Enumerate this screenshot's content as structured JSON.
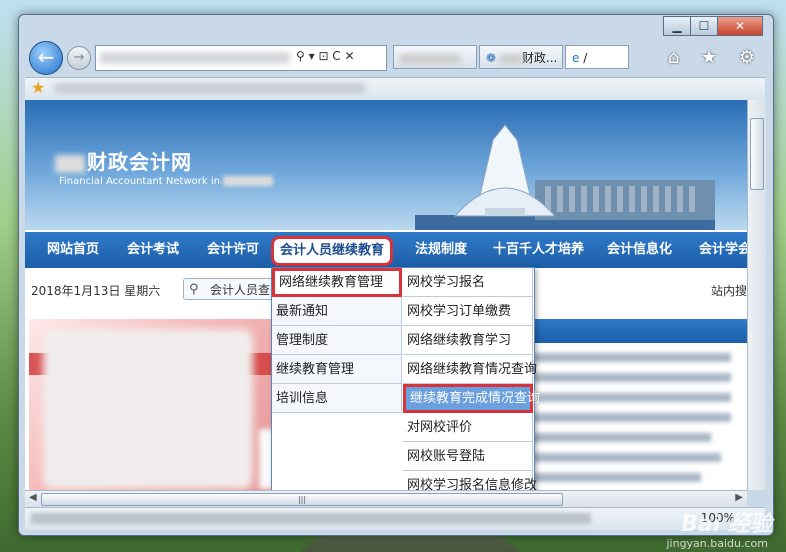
{
  "browser": {
    "window_controls": {
      "minimize": "▁",
      "maximize": "☐",
      "close": "✕"
    },
    "back_icon": "arrow-left",
    "forward_icon": "arrow-right",
    "address_icons": "⚲ ▾ ⊡ C ✕",
    "tabs": [
      {
        "label": "",
        "active": false
      },
      {
        "label": "财政...",
        "active": false
      },
      {
        "label": "/",
        "active": true
      }
    ],
    "tool_icons": "⌂ ★ ⚙",
    "zoom": "100%"
  },
  "site": {
    "title": "财政会计网",
    "subtitle": "Financial Accountant Network in",
    "nav": [
      {
        "label": "网站首页"
      },
      {
        "label": "会计考试"
      },
      {
        "label": "会计许可"
      },
      {
        "label": "会计人员继续教育",
        "selected": true
      },
      {
        "label": "法规制度"
      },
      {
        "label": "十百千人才培养"
      },
      {
        "label": "会计信息化"
      },
      {
        "label": "会计学会"
      }
    ],
    "date": "2018年1月13日  星期六",
    "search_value": "会计人员查",
    "site_search": "站内搜"
  },
  "dropdown": {
    "left": [
      {
        "label": "网络继续教育管理",
        "highlight": "outline"
      },
      {
        "label": "最新通知"
      },
      {
        "label": "管理制度"
      },
      {
        "label": "继续教育管理"
      },
      {
        "label": "培训信息"
      }
    ],
    "right": [
      {
        "label": "网校学习报名"
      },
      {
        "label": "网校学习订单缴费"
      },
      {
        "label": "网络继续教育学习"
      },
      {
        "label": "网络继续教育情况查询"
      },
      {
        "label": "继续教育完成情况查询",
        "highlight": "selected"
      },
      {
        "label": "对网校评价"
      },
      {
        "label": "网校账号登陆"
      },
      {
        "label": "网校学习报名信息修改"
      }
    ]
  },
  "watermark": {
    "main": "Bai 经验",
    "sub": "jingyan.baidu.com"
  },
  "colors": {
    "nav_blue": "#1d5ea8",
    "highlight_red": "#d8323a",
    "selected_blue": "#6aa0de"
  }
}
